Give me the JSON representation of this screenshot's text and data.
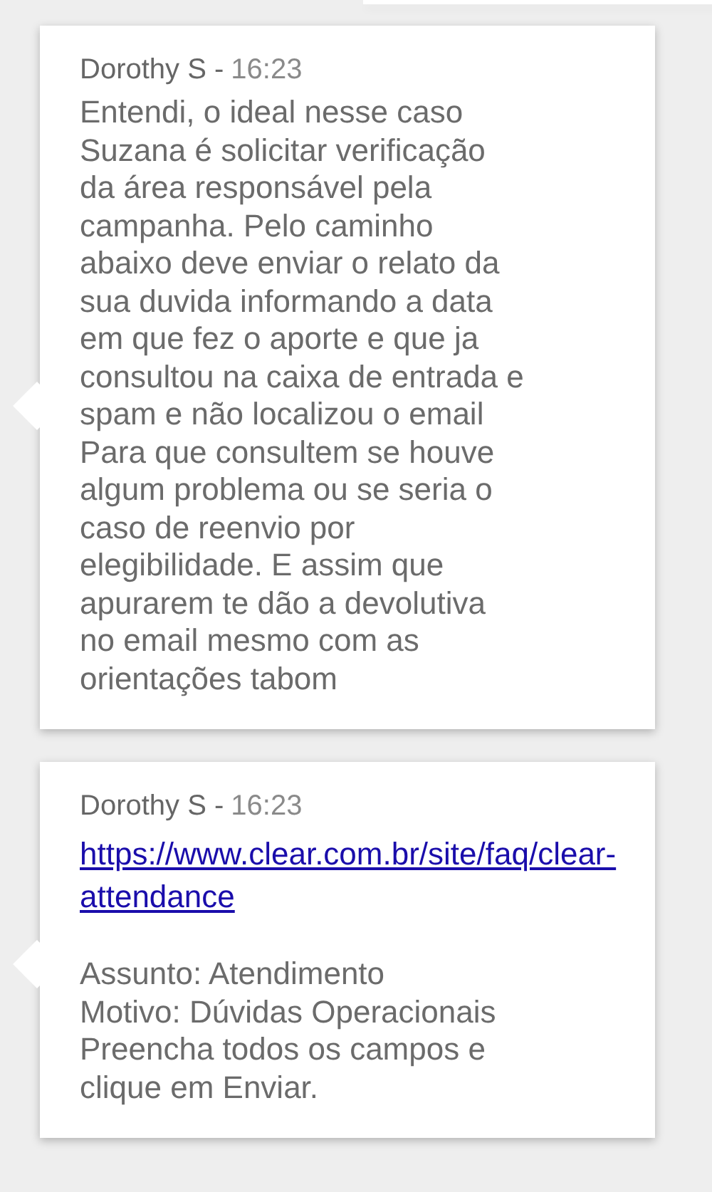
{
  "messages": [
    {
      "sender": "Dorothy S -",
      "time": "16:23",
      "lines": [
        "Entendi, o ideal nesse caso",
        "Suzana é solicitar verificação",
        "da área responsável pela",
        "campanha. Pelo caminho",
        "abaixo deve enviar o relato da",
        "sua duvida informando a data",
        "em que fez o aporte e que ja",
        "consultou na caixa de entrada e",
        "spam e não localizou o email",
        "Para que consultem se houve",
        "algum problema ou se seria o",
        "caso de reenvio por",
        "elegibilidade. E assim que",
        "apurarem te dão a devolutiva",
        "no email mesmo com as",
        "orientações tabom"
      ]
    },
    {
      "sender": "Dorothy S -",
      "time": "16:23",
      "link": "https://www.clear.com.br/site/faq/clear-attendance",
      "lines": [
        "Assunto: Atendimento",
        "Motivo: Dúvidas Operacionais",
        "Preencha todos os campos e",
        "clique em Enviar."
      ]
    }
  ]
}
